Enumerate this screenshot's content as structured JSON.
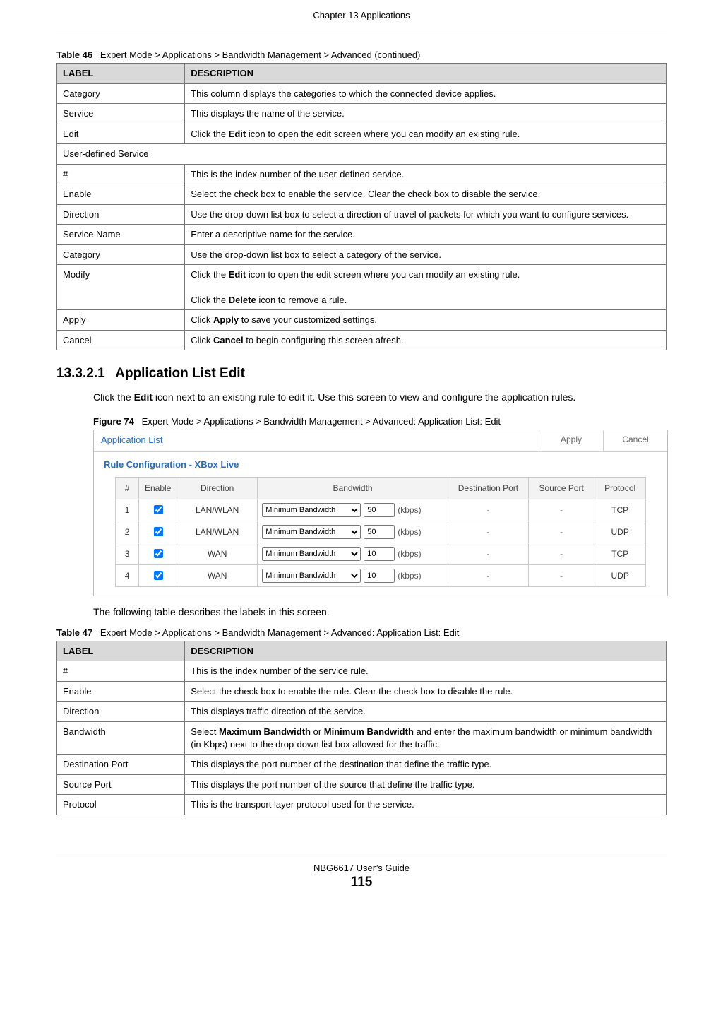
{
  "chapter_header": "Chapter 13 Applications",
  "table46": {
    "caption_prefix": "Table 46",
    "caption": "Expert Mode > Applications > Bandwidth Management > Advanced (continued)",
    "head_label": "LABEL",
    "head_desc": "DESCRIPTION",
    "rows": [
      {
        "label": "Category",
        "desc_html": "This column displays the categories to which the connected device applies."
      },
      {
        "label": "Service",
        "desc_html": "This displays the name of the service."
      },
      {
        "label": "Edit",
        "desc_html": "Click the <b>Edit</b> icon to open the edit screen where you can modify an existing rule."
      },
      {
        "span": true,
        "label": "User-defined Service"
      },
      {
        "label": "#",
        "desc_html": "This is the index number of the user-defined service."
      },
      {
        "label": "Enable",
        "desc_html": "Select the check box to enable the service. Clear the check box to disable the service."
      },
      {
        "label": "Direction",
        "desc_html": "Use the drop-down list box to select a direction of travel of packets for which you want to configure services."
      },
      {
        "label": "Service Name",
        "desc_html": "Enter a descriptive name for the service."
      },
      {
        "label": "Category",
        "desc_html": "Use the drop-down list box to select a category of the service."
      },
      {
        "label": "Modify",
        "desc_html": "Click the <b>Edit</b> icon to open the edit screen where you can modify an existing rule.<br><br>Click the <b>Delete</b> icon to remove a rule."
      },
      {
        "label": "Apply",
        "desc_html": "Click <b>Apply</b> to save your customized settings."
      },
      {
        "label": "Cancel",
        "desc_html": "Click <b>Cancel</b> to begin configuring this screen afresh."
      }
    ]
  },
  "section": {
    "number": "13.3.2.1",
    "title": "Application List Edit",
    "p1_html": "Click the <b>Edit</b> icon next to an existing rule to edit it. Use this screen to view and configure the application rules.",
    "p2": "The following table describes the labels in this screen."
  },
  "figure74": {
    "caption_prefix": "Figure 74",
    "caption": "Expert Mode > Applications > Bandwidth Management > Advanced: Application List: Edit",
    "tab_label": "Application List",
    "apply_btn": "Apply",
    "cancel_btn": "Cancel",
    "rule_title": "Rule Configuration - XBox Live",
    "cols": {
      "idx": "#",
      "enable": "Enable",
      "direction": "Direction",
      "bandwidth": "Bandwidth",
      "dport": "Destination Port",
      "sport": "Source Port",
      "proto": "Protocol"
    },
    "bw_select": "Minimum Bandwidth",
    "kbps": "(kbps)",
    "rows": [
      {
        "idx": "1",
        "enable": true,
        "direction": "LAN/WLAN",
        "bw": "50",
        "dport": "-",
        "sport": "-",
        "proto": "TCP"
      },
      {
        "idx": "2",
        "enable": true,
        "direction": "LAN/WLAN",
        "bw": "50",
        "dport": "-",
        "sport": "-",
        "proto": "UDP"
      },
      {
        "idx": "3",
        "enable": true,
        "direction": "WAN",
        "bw": "10",
        "dport": "-",
        "sport": "-",
        "proto": "TCP"
      },
      {
        "idx": "4",
        "enable": true,
        "direction": "WAN",
        "bw": "10",
        "dport": "-",
        "sport": "-",
        "proto": "UDP"
      }
    ]
  },
  "table47": {
    "caption_prefix": "Table 47",
    "caption": "Expert Mode > Applications > Bandwidth Management > Advanced: Application List: Edit",
    "head_label": "LABEL",
    "head_desc": "DESCRIPTION",
    "rows": [
      {
        "label": "#",
        "desc_html": "This is the index number of the service rule."
      },
      {
        "label": "Enable",
        "desc_html": "Select the check box to enable the rule. Clear the check box to disable the rule."
      },
      {
        "label": "Direction",
        "desc_html": "This displays traffic direction of the service."
      },
      {
        "label": "Bandwidth",
        "desc_html": "Select <b>Maximum Bandwidth</b> or <b>Minimum Bandwidth</b> and enter the maximum bandwidth or minimum bandwidth (in Kbps) next to the drop-down list box allowed for the traffic."
      },
      {
        "label": "Destination Port",
        "desc_html": "This displays the port number of the destination that define the traffic type."
      },
      {
        "label": "Source Port",
        "desc_html": "This displays the port number of the source that define the traffic type."
      },
      {
        "label": "Protocol",
        "desc_html": "This is the transport layer protocol used for the service."
      }
    ]
  },
  "footer": {
    "guide": "NBG6617 User’s Guide",
    "page": "115"
  }
}
